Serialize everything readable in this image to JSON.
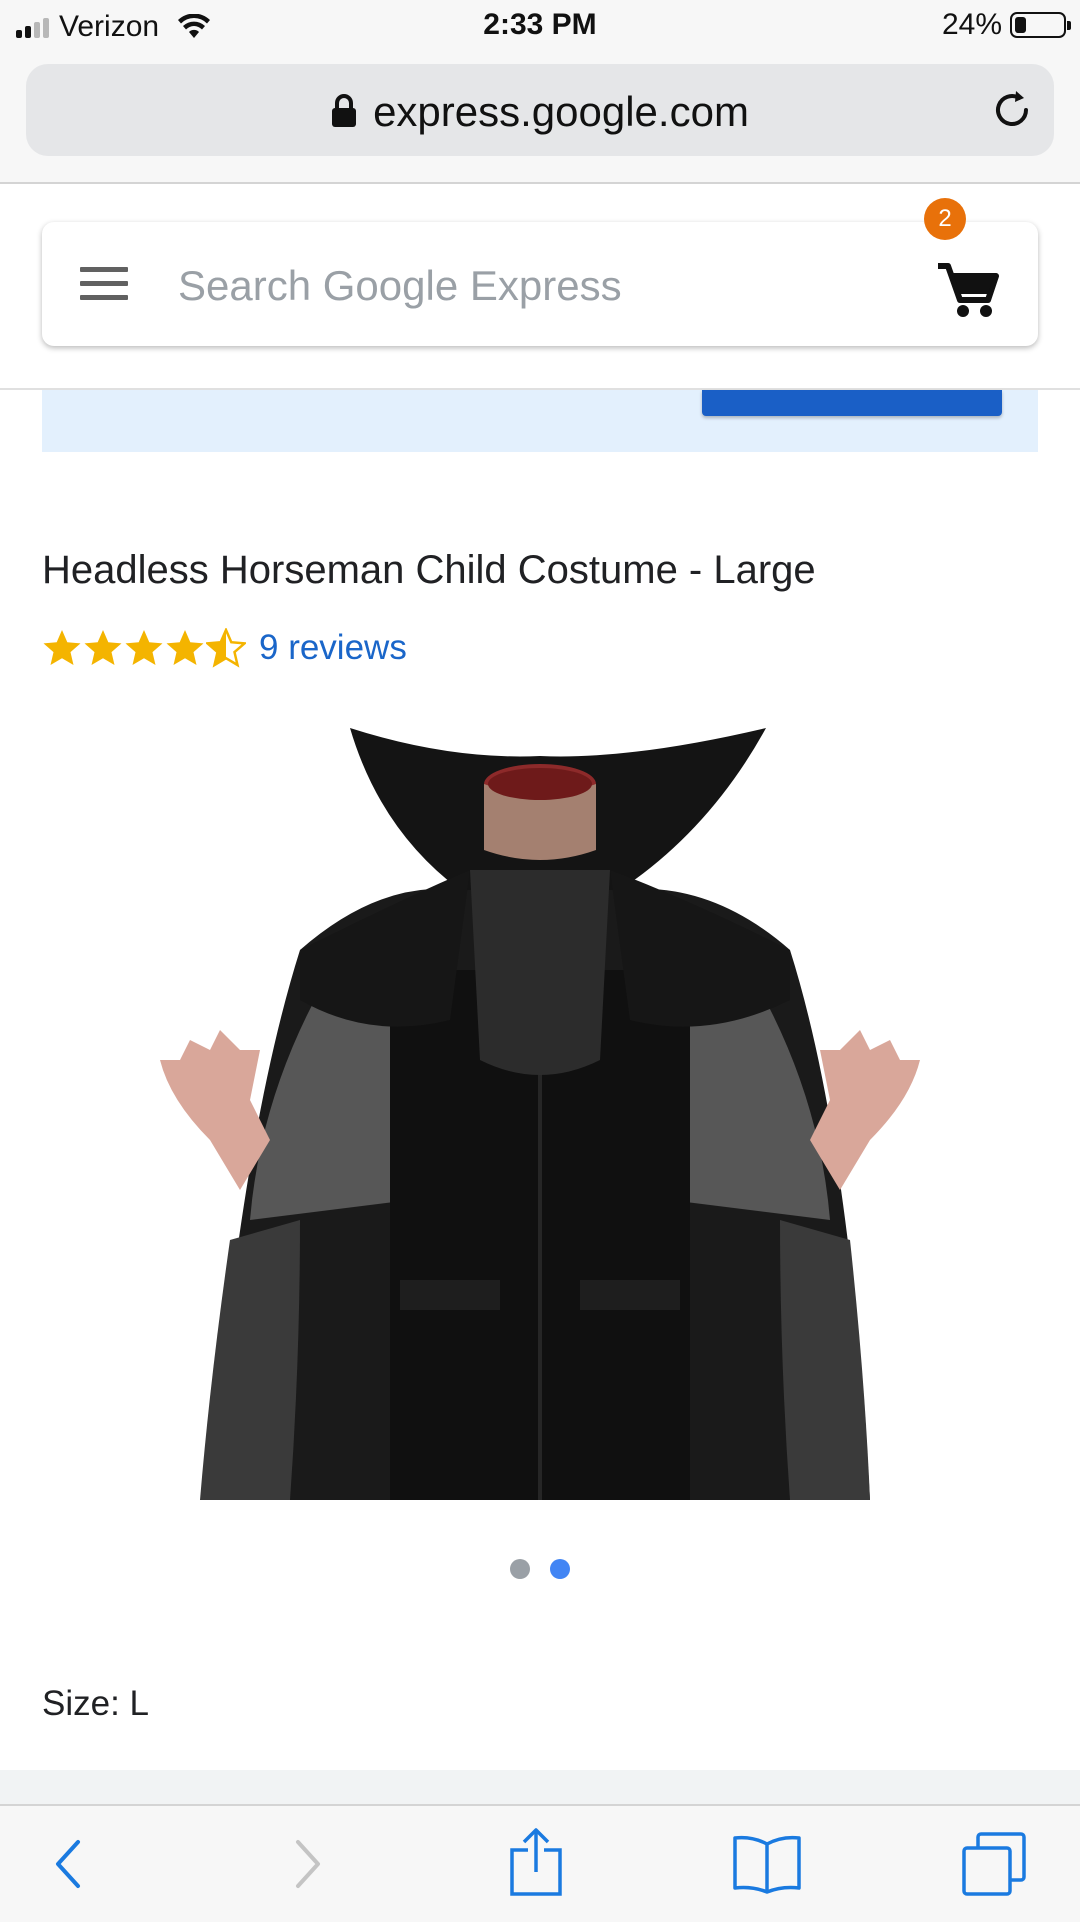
{
  "status_bar": {
    "carrier": "Verizon",
    "time": "2:33 PM",
    "battery_percent": "24%",
    "battery_level": 0.24
  },
  "browser": {
    "url": "express.google.com"
  },
  "header": {
    "search_placeholder": "Search Google Express",
    "cart_count": "2"
  },
  "product": {
    "title": "Headless Horseman Child Costume - Large",
    "rating": 4.5,
    "reviews_label": "9 reviews",
    "image_count": 2,
    "active_image_index": 1,
    "size_label": "Size: L"
  },
  "colors": {
    "star": "#f4b400",
    "link": "#1a66c9",
    "cart_badge": "#e8710a",
    "safari_blue": "#1a7ae0"
  }
}
